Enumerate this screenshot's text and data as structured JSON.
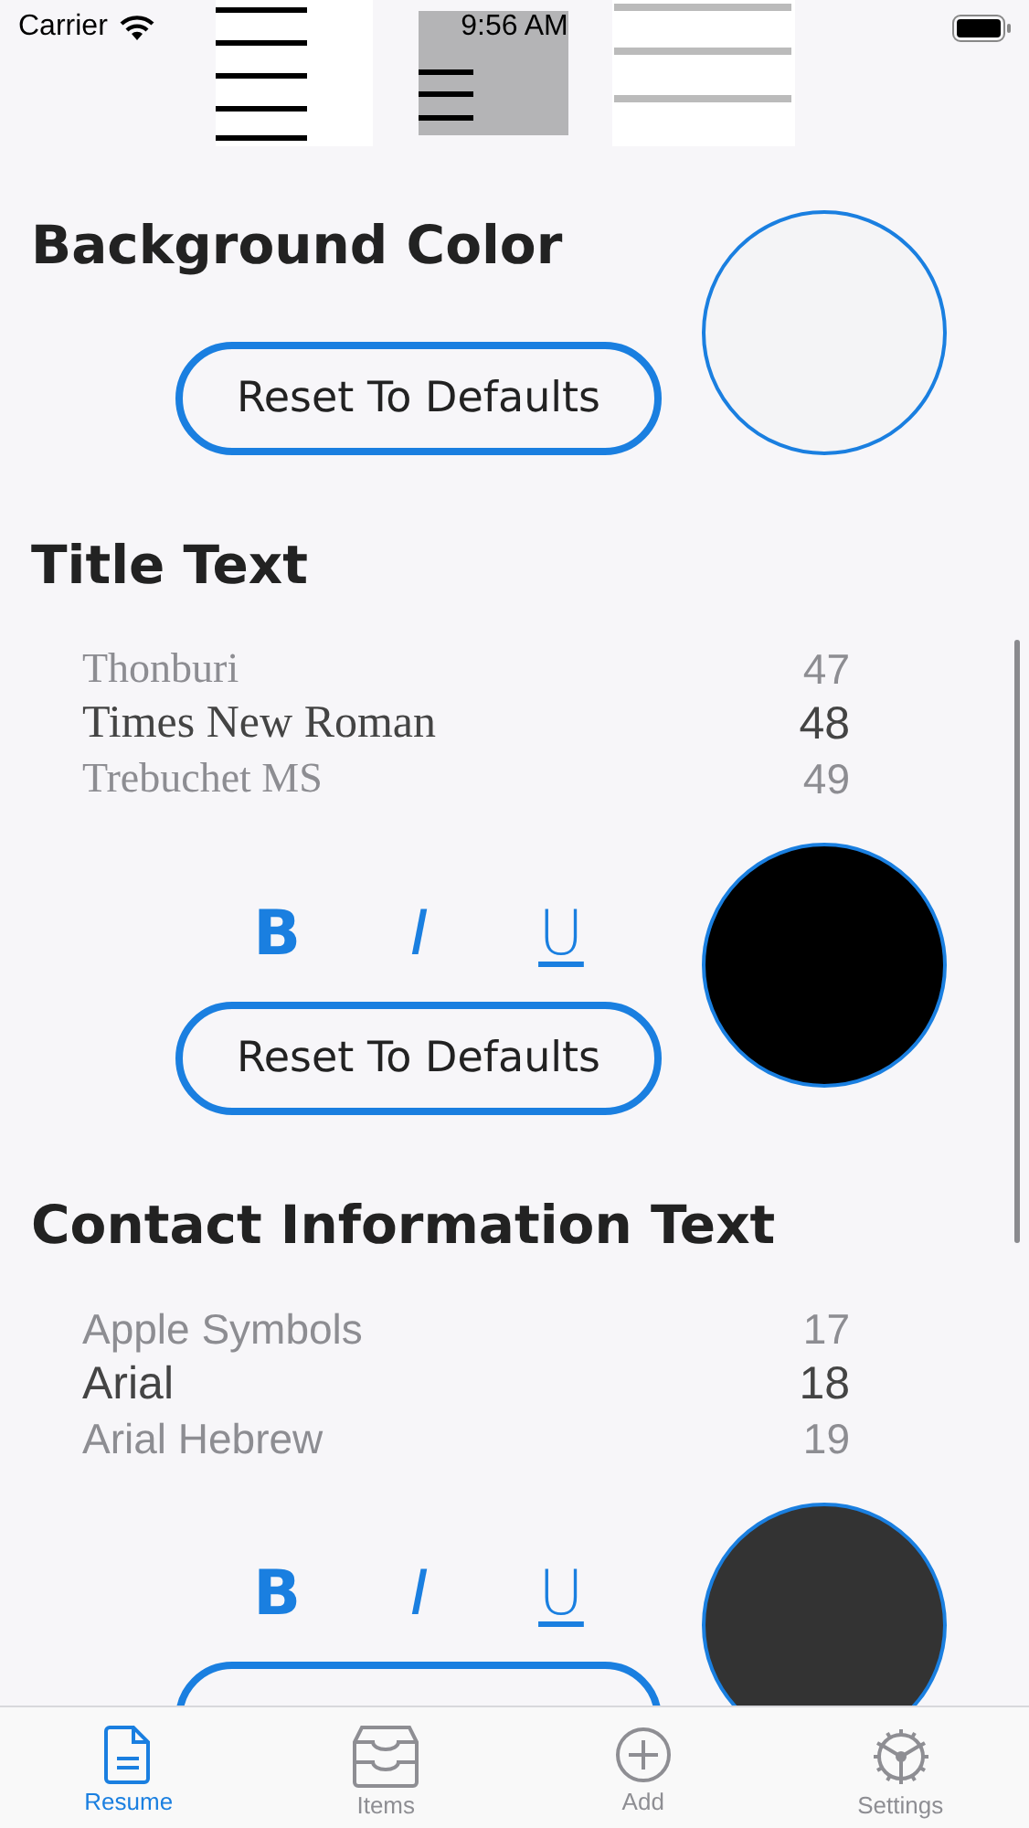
{
  "status_bar": {
    "carrier": "Carrier",
    "time": "9:56 AM"
  },
  "thumbnails": [
    {
      "kind": "lines"
    },
    {
      "kind": "dark"
    },
    {
      "kind": "light"
    }
  ],
  "sections": [
    {
      "title": "Background Color",
      "color": "#f4f4f6",
      "button": "Reset To Defaults"
    },
    {
      "title": "Title Text",
      "picker": {
        "fonts": [
          "Thonburi",
          "Times New Roman",
          "Trebuchet MS"
        ],
        "sizes": [
          "47",
          "48",
          "49"
        ]
      },
      "styles": [
        "B",
        "I",
        "U"
      ],
      "color": "#000000",
      "button": "Reset To Defaults"
    },
    {
      "title": "Contact Information Text",
      "picker": {
        "fonts": [
          "Apple Symbols",
          "Arial",
          "Arial Hebrew"
        ],
        "sizes": [
          "17",
          "18",
          "19"
        ]
      },
      "styles": [
        "B",
        "I",
        "U"
      ],
      "color": "#333333"
    }
  ],
  "tab_bar": [
    {
      "label": "Resume",
      "selected": true
    },
    {
      "label": "Items",
      "selected": false
    },
    {
      "label": "Add",
      "selected": false
    },
    {
      "label": "Settings",
      "selected": false
    }
  ]
}
